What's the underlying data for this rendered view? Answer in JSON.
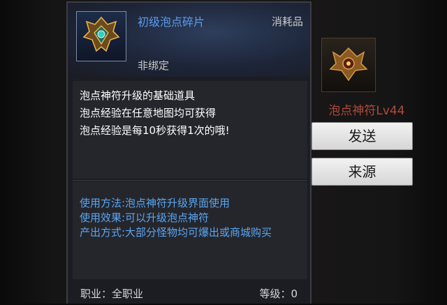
{
  "tooltip": {
    "item_name": "初级泡点碎片",
    "item_type": "消耗品",
    "bind_state": "非绑定",
    "icon": "emblem-icon",
    "description": [
      "泡点神符升级的基础道具",
      "泡点经验在任意地图均可获得",
      "泡点经验是每10秒获得1次的哦!"
    ],
    "usage": [
      "使用方法:泡点神符升级界面使用",
      "使用效果:可以升级泡点神符",
      "产出方式:大部分怪物均可爆出或商城购买"
    ],
    "class_label": "职业：全职业",
    "level_label": "等级：0"
  },
  "background_panel": {
    "item_name": "泡点神符Lv44",
    "icon": "rune-icon",
    "send_label": "发送",
    "source_label": "来源"
  },
  "colors": {
    "name_blue": "#5b9cf0",
    "usage_blue": "#5aa6f2",
    "bg_item_red": "#b04a3b"
  }
}
